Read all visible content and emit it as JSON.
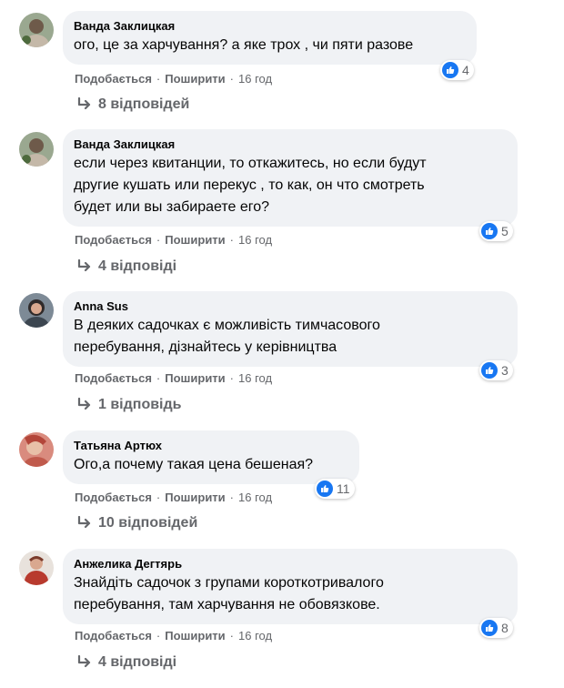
{
  "comments": [
    {
      "author": "Ванда Заклицкая",
      "lines": [
        "ого, це за харчування? а яке трох , чи пяти разове"
      ],
      "reaction_count": "4",
      "like_label": "Подобається",
      "share_label": "Поширити",
      "time": "16 год",
      "replies": "8 відповідей",
      "avatar_color": "#8a9a7c"
    },
    {
      "author": "Ванда Заклицкая",
      "lines": [
        "если через квитанции, то откажитесь, но если будут",
        "другие кушать или перекус , то как, он что смотреть",
        "будет или вы забираете его?"
      ],
      "reaction_count": "5",
      "like_label": "Подобається",
      "share_label": "Поширити",
      "time": "16 год",
      "replies": "4 відповіді",
      "avatar_color": "#8a9a7c"
    },
    {
      "author": "Anna Sus",
      "lines": [
        "В деяких садочках є можливість тимчасового",
        "перебування, дізнайтесь у керівництва"
      ],
      "reaction_count": "3",
      "like_label": "Подобається",
      "share_label": "Поширити",
      "time": "16 год",
      "replies": "1 відповідь",
      "avatar_color": "#5c6b7a"
    },
    {
      "author": "Татьяна Артюх",
      "lines": [
        "Ого,а почему такая цена бешеная?"
      ],
      "reaction_count": "11",
      "like_label": "Подобається",
      "share_label": "Поширити",
      "time": "16 год",
      "replies": "10 відповідей",
      "avatar_color": "#c9736a"
    },
    {
      "author": "Анжелика Дегтярь",
      "lines": [
        "Знайдіть садочок з групами короткотривалого",
        "перебування, там харчування не обовязкове."
      ],
      "reaction_count": "8",
      "like_label": "Подобається",
      "share_label": "Поширити",
      "time": "16 год",
      "replies": "4 відповіді",
      "avatar_color": "#b05a4a"
    }
  ]
}
